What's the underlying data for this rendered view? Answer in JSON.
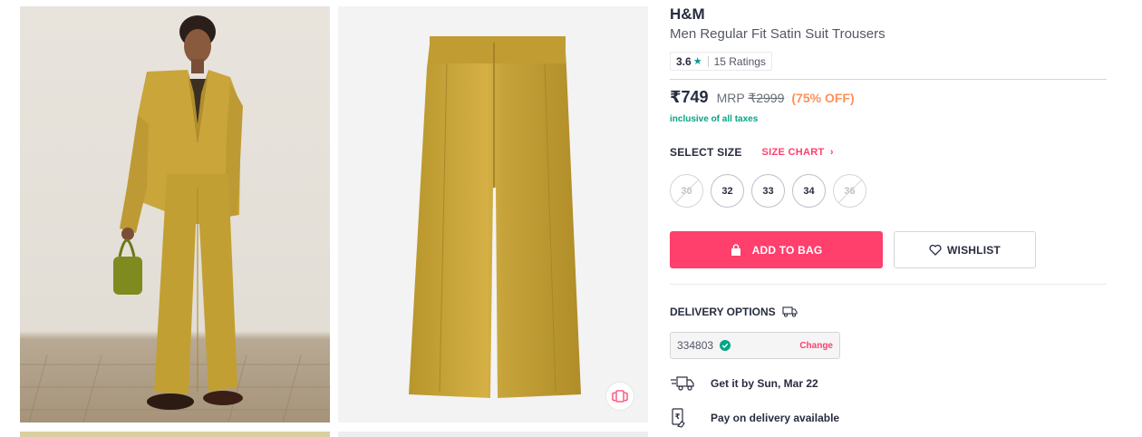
{
  "gallery": {
    "images": [
      {
        "icon": "model-wearing-suit-photo"
      },
      {
        "icon": "trousers-product-photo"
      },
      {
        "icon": "product-photo-partial"
      },
      {
        "icon": "product-photo-partial"
      }
    ],
    "similar_icon": "similar-products-icon"
  },
  "product": {
    "brand": "H&M",
    "name": "Men Regular Fit Satin Suit Trousers",
    "rating": {
      "value": "3.6",
      "star": "★",
      "count_text": "15 Ratings"
    },
    "price": "₹749",
    "mrp_label": "MRP",
    "mrp_value": "₹2999",
    "discount": "(75% OFF)",
    "tax_note": "inclusive of all taxes"
  },
  "size_section": {
    "title": "SELECT SIZE",
    "chart_label": "SIZE CHART",
    "chart_chevron": "›",
    "sizes": [
      {
        "label": "30",
        "available": false
      },
      {
        "label": "32",
        "available": true
      },
      {
        "label": "33",
        "available": true
      },
      {
        "label": "34",
        "available": true
      },
      {
        "label": "36",
        "available": false
      }
    ]
  },
  "actions": {
    "add_to_bag": "ADD TO BAG",
    "wishlist": "WISHLIST"
  },
  "delivery": {
    "title": "DELIVERY OPTIONS",
    "pincode": "334803",
    "change_label": "Change",
    "eta": "Get it by Sun, Mar 22",
    "pay_on_delivery": "Pay on delivery available"
  },
  "colors": {
    "accent": "#ff3f6c",
    "discount": "#ff905a",
    "success": "#03a685",
    "text": "#282c3f"
  }
}
